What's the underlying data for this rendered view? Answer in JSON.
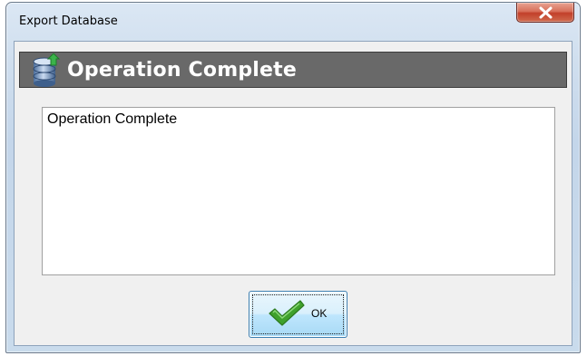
{
  "window": {
    "title": "Export Database"
  },
  "header": {
    "icon": "database-export-icon",
    "title": "Operation Complete"
  },
  "message": {
    "text": "Operation Complete"
  },
  "buttons": {
    "ok_label": "OK",
    "ok_icon": "checkmark-icon",
    "close_icon": "close-icon"
  },
  "colors": {
    "header_band": "#696969",
    "close_button": "#c2402a",
    "checkmark": "#3fa12c"
  }
}
